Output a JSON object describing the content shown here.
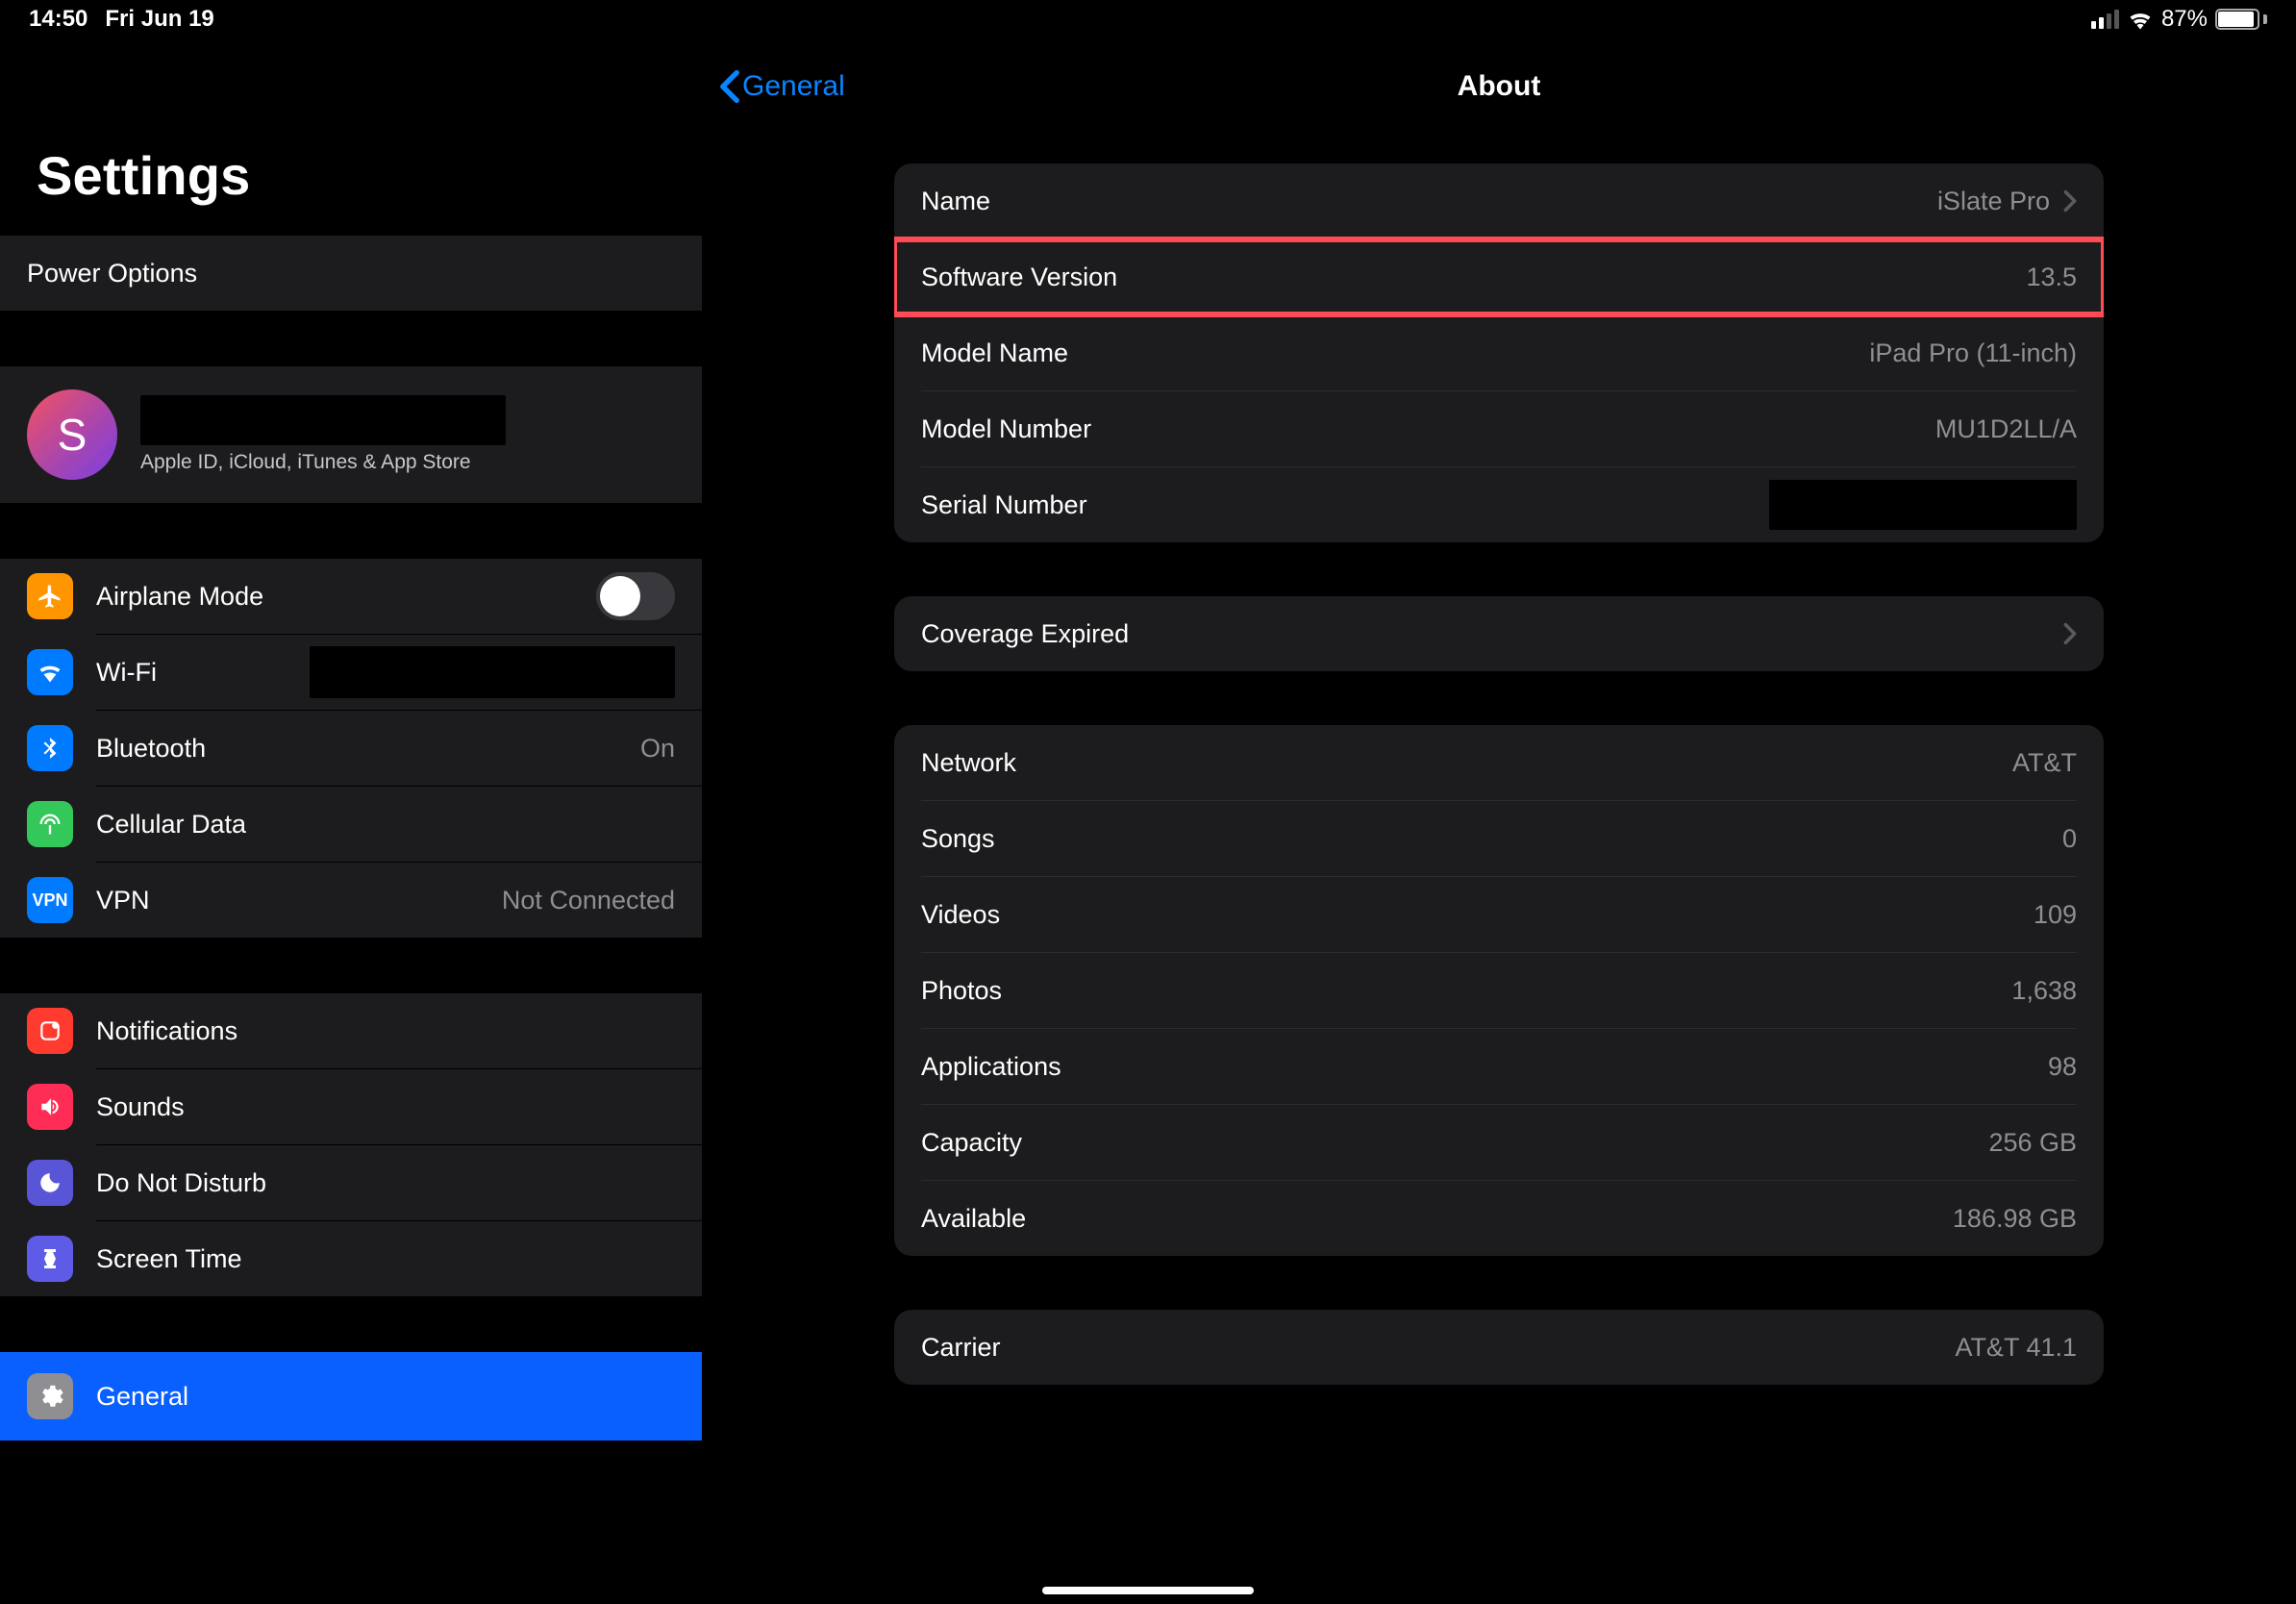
{
  "status": {
    "time": "14:50",
    "date": "Fri Jun 19",
    "battery_pct": "87%"
  },
  "sidebar": {
    "title": "Settings",
    "power_options": "Power Options",
    "account": {
      "initial": "S",
      "subtitle": "Apple ID, iCloud, iTunes & App Store"
    },
    "airplane": "Airplane Mode",
    "wifi": "Wi-Fi",
    "bluetooth": {
      "label": "Bluetooth",
      "value": "On"
    },
    "cellular": "Cellular Data",
    "vpn": {
      "label": "VPN",
      "value": "Not Connected"
    },
    "notifications": "Notifications",
    "sounds": "Sounds",
    "dnd": "Do Not Disturb",
    "screentime": "Screen Time",
    "general": "General"
  },
  "detail": {
    "back": "General",
    "title": "About",
    "group1": {
      "name": {
        "label": "Name",
        "value": "iSlate Pro"
      },
      "swver": {
        "label": "Software Version",
        "value": "13.5"
      },
      "modelname": {
        "label": "Model Name",
        "value": "iPad Pro (11-inch)"
      },
      "modelnum": {
        "label": "Model Number",
        "value": "MU1D2LL/A"
      },
      "serial": {
        "label": "Serial Number"
      }
    },
    "group2": {
      "coverage": "Coverage Expired"
    },
    "group3": {
      "network": {
        "label": "Network",
        "value": "AT&T"
      },
      "songs": {
        "label": "Songs",
        "value": "0"
      },
      "videos": {
        "label": "Videos",
        "value": "109"
      },
      "photos": {
        "label": "Photos",
        "value": "1,638"
      },
      "apps": {
        "label": "Applications",
        "value": "98"
      },
      "capacity": {
        "label": "Capacity",
        "value": "256 GB"
      },
      "available": {
        "label": "Available",
        "value": "186.98 GB"
      }
    },
    "group4": {
      "carrier": {
        "label": "Carrier",
        "value": "AT&T 41.1"
      }
    }
  },
  "colors": {
    "ic_orange": "#ff9500",
    "ic_blue": "#007aff",
    "ic_green": "#34c759",
    "ic_navy": "#0a60d8",
    "ic_red": "#ff3b30",
    "ic_pink": "#ff2d55",
    "ic_purple": "#5856d6",
    "ic_indigo": "#5e5ce6",
    "ic_gray": "#8e8e93"
  }
}
